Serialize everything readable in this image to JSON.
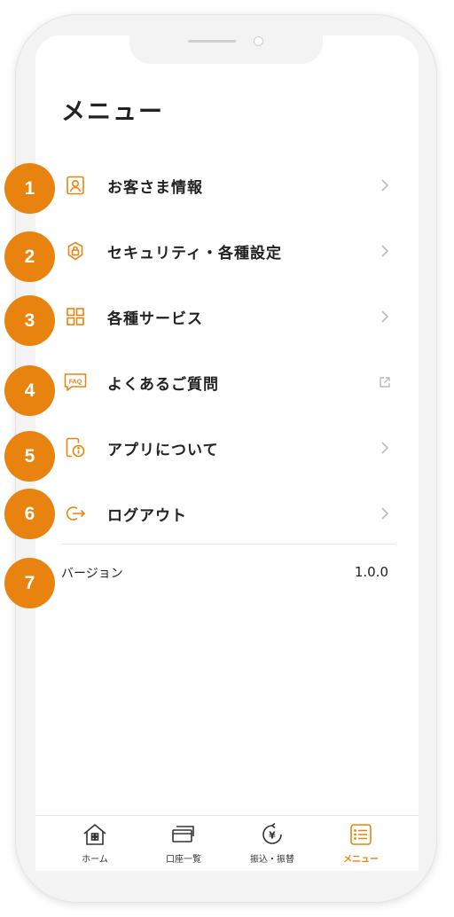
{
  "page_title": "メニュー",
  "menu": {
    "items": [
      {
        "label": "お客さま情報",
        "icon": "person-card-icon",
        "badge": "1"
      },
      {
        "label": "セキュリティ・各種設定",
        "icon": "shield-lock-icon",
        "badge": "2"
      },
      {
        "label": "各種サービス",
        "icon": "grid-icon",
        "badge": "3"
      },
      {
        "label": "よくあるご質問",
        "icon": "faq-chat-icon",
        "badge": "4"
      },
      {
        "label": "アプリについて",
        "icon": "app-info-icon",
        "badge": "5"
      },
      {
        "label": "ログアウト",
        "icon": "logout-icon",
        "badge": "6"
      }
    ]
  },
  "version": {
    "label": "バージョン",
    "value": "1.0.0",
    "badge": "7"
  },
  "tabbar": {
    "tabs": [
      {
        "label": "ホーム",
        "icon": "home-icon"
      },
      {
        "label": "口座一覧",
        "icon": "card-stack-icon"
      },
      {
        "label": "振込・振替",
        "icon": "yen-transfer-icon"
      },
      {
        "label": "メニュー",
        "icon": "menu-list-icon",
        "active": true
      }
    ]
  },
  "colors": {
    "accent": "#e8830f",
    "text": "#222222",
    "chevron": "#bbbbbb"
  }
}
